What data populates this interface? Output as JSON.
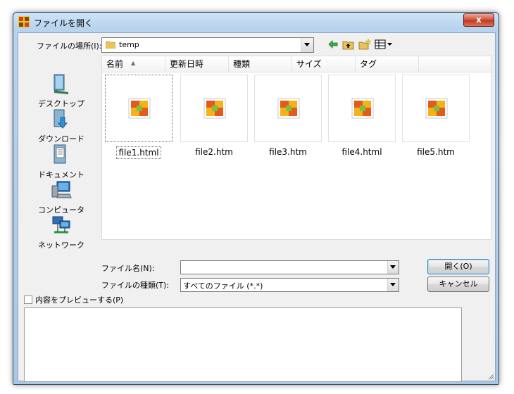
{
  "window": {
    "title": "ファイルを開く",
    "close_label": "x"
  },
  "lookin": {
    "label": "ファイルの場所(I):",
    "value": "temp"
  },
  "toolbar": {
    "icons": [
      "back-icon",
      "up-folder-icon",
      "new-folder-icon",
      "view-menu-icon"
    ]
  },
  "places": [
    {
      "label": "デスクトップ",
      "icon": "desktop-icon"
    },
    {
      "label": "ダウンロード",
      "icon": "downloads-icon"
    },
    {
      "label": "ドキュメント",
      "icon": "documents-icon"
    },
    {
      "label": "コンピュータ",
      "icon": "computer-icon"
    },
    {
      "label": "ネットワーク",
      "icon": "network-icon"
    }
  ],
  "columns": [
    "名前",
    "更新日時",
    "種類",
    "サイズ",
    "タグ"
  ],
  "files": [
    {
      "name": "file1.html",
      "selected": true
    },
    {
      "name": "file2.htm",
      "selected": false
    },
    {
      "name": "file3.htm",
      "selected": false
    },
    {
      "name": "file4.html",
      "selected": false
    },
    {
      "name": "file5.htm",
      "selected": false
    }
  ],
  "filename": {
    "label": "ファイル名(N):",
    "value": ""
  },
  "filetype": {
    "label": "ファイルの種類(T):",
    "value": "すべてのファイル (*.*)"
  },
  "buttons": {
    "open": "開く(O)",
    "cancel": "キャンセル"
  },
  "preview": {
    "label": "内容をプレビューする(P)",
    "checked": false
  },
  "colors": {
    "title_bar": "#b7d3ee",
    "close_button": "#c03a20",
    "client_bg": "#f0f0f0"
  }
}
